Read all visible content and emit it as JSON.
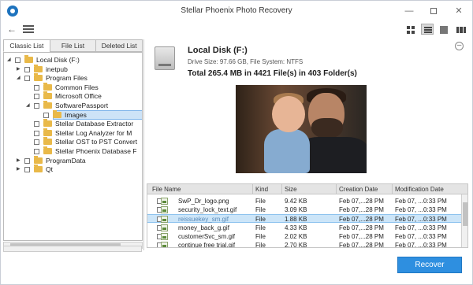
{
  "window": {
    "title": "Stellar Phoenix Photo Recovery",
    "controls": {
      "minimize": "—",
      "close": "✕"
    }
  },
  "toolbar": {
    "back_icon": "arrow-left-icon",
    "menu_icon": "hamburger-menu-icon",
    "view_modes": [
      "grid-view-icon",
      "list-view-icon",
      "details-view-icon",
      "filmstrip-view-icon"
    ],
    "active_view": 1
  },
  "tabs": [
    {
      "label": "Classic List",
      "active": true
    },
    {
      "label": "File List",
      "active": false
    },
    {
      "label": "Deleted List",
      "active": false
    }
  ],
  "tree": [
    {
      "label": "Local Disk (F:)",
      "level": 0,
      "expander": "collapse",
      "selected": false
    },
    {
      "label": "inetpub",
      "level": 1,
      "expander": "expand",
      "selected": false
    },
    {
      "label": "Program Files",
      "level": 1,
      "expander": "collapse",
      "selected": false
    },
    {
      "label": "Common Files",
      "level": 2,
      "expander": "none",
      "selected": false
    },
    {
      "label": "Microsoft Office",
      "level": 2,
      "expander": "none",
      "selected": false
    },
    {
      "label": "SoftwarePassport",
      "level": 2,
      "expander": "collapse",
      "selected": false
    },
    {
      "label": "Images",
      "level": 3,
      "expander": "none",
      "selected": true
    },
    {
      "label": "Stellar Database Extractor",
      "level": 2,
      "expander": "none",
      "selected": false
    },
    {
      "label": "Stellar Log Analyzer for M",
      "level": 2,
      "expander": "none",
      "selected": false
    },
    {
      "label": "Stellar OST to PST Convert",
      "level": 2,
      "expander": "none",
      "selected": false
    },
    {
      "label": "Stellar Phoenix Database F",
      "level": 2,
      "expander": "none",
      "selected": false
    },
    {
      "label": "ProgramData",
      "level": 1,
      "expander": "expand",
      "selected": false
    },
    {
      "label": "Qt",
      "level": 1,
      "expander": "expand",
      "selected": false
    }
  ],
  "disk": {
    "name": "Local Disk (F:)",
    "info": "Drive Size: 97.66 GB, File System: NTFS",
    "total": "Total 265.4 MB in 4421 File(s) in 403 Folder(s)"
  },
  "file_list": {
    "columns": [
      "File Name",
      "Kind",
      "Size",
      "Creation Date",
      "Modification Date"
    ],
    "rows": [
      {
        "name": "SwP_Dr_logo.png",
        "kind": "File",
        "size": "9.42 KB",
        "created": "Feb 07,...28 PM",
        "modified": "Feb 07, ...0:33 PM",
        "selected": false
      },
      {
        "name": "security_lock_text.gif",
        "kind": "File",
        "size": "3.09 KB",
        "created": "Feb 07,...28 PM",
        "modified": "Feb 07, ...0:33 PM",
        "selected": false
      },
      {
        "name": "reissuekey_sm.gif",
        "kind": "File",
        "size": "1.88 KB",
        "created": "Feb 07,...28 PM",
        "modified": "Feb 07, ...0:33 PM",
        "selected": true
      },
      {
        "name": "money_back_g.gif",
        "kind": "File",
        "size": "4.33 KB",
        "created": "Feb 07,...28 PM",
        "modified": "Feb 07, ...0:33 PM",
        "selected": false
      },
      {
        "name": "customerSvc_sm.gif",
        "kind": "File",
        "size": "2.02 KB",
        "created": "Feb 07,...28 PM",
        "modified": "Feb 07, ...0:33 PM",
        "selected": false
      },
      {
        "name": "continue free trial.gif",
        "kind": "File",
        "size": "2.70 KB",
        "created": "Feb 07,...28 PM",
        "modified": "Feb 07, ...0:33 PM",
        "selected": false
      }
    ]
  },
  "actions": {
    "recover_label": "Recover"
  },
  "colors": {
    "accent": "#2e8fe0",
    "selection": "#cce5f8",
    "folder": "#e9b949"
  }
}
